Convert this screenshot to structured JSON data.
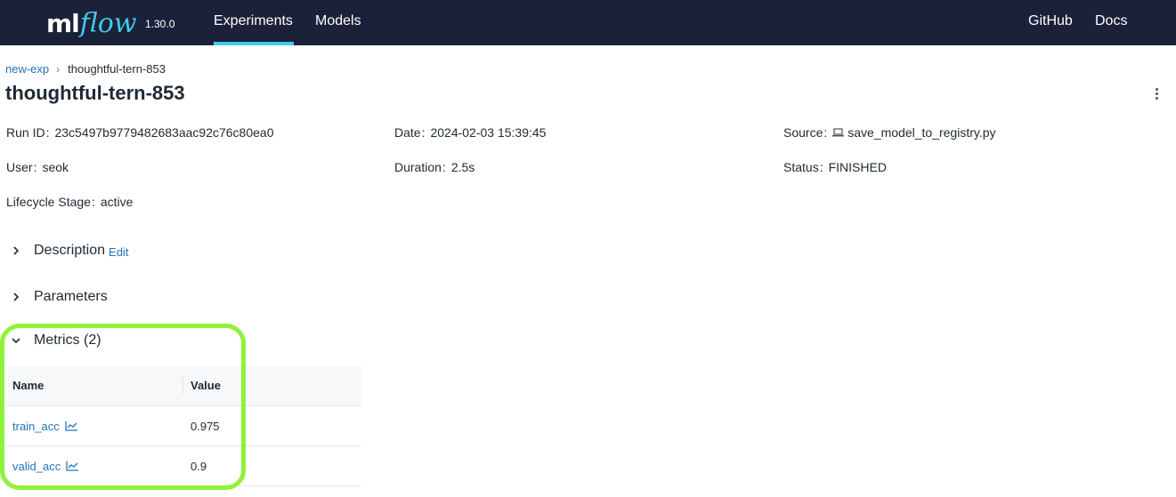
{
  "nav": {
    "logo_ml": "ml",
    "logo_flow": "flow",
    "version": "1.30.0",
    "experiments": "Experiments",
    "models": "Models",
    "github": "GitHub",
    "docs": "Docs",
    "accent_color": "#43c9ed",
    "background_color": "#1b2138"
  },
  "breadcrumb": {
    "parent": "new-exp",
    "separator": "›",
    "current": "thoughtful-tern-853"
  },
  "page": {
    "title": "thoughtful-tern-853",
    "menu_icon": "kebab-menu-icon"
  },
  "metadata": {
    "run_id": {
      "key": "Run ID",
      "value": "23c5497b9779482683aac92c76c80ea0"
    },
    "date": {
      "key": "Date",
      "value": "2024-02-03 15:39:45"
    },
    "source": {
      "key": "Source",
      "value": "save_model_to_registry.py",
      "icon": "laptop-icon"
    },
    "user": {
      "key": "User",
      "value": "seok"
    },
    "duration": {
      "key": "Duration",
      "value": "2.5s"
    },
    "status": {
      "key": "Status",
      "value": "FINISHED"
    },
    "lifecycle": {
      "key": "Lifecycle Stage",
      "value": "active"
    },
    "colon": ":"
  },
  "sections": {
    "description": {
      "title": "Description",
      "edit": "Edit",
      "expanded": false
    },
    "parameters": {
      "title": "Parameters",
      "expanded": false
    },
    "metrics": {
      "title": "Metrics (2)",
      "expanded": true
    }
  },
  "metrics_table": {
    "headers": {
      "name": "Name",
      "value": "Value"
    },
    "rows": [
      {
        "name": "train_acc",
        "value": "0.975",
        "icon": "line-chart-icon"
      },
      {
        "name": "valid_acc",
        "value": "0.9",
        "icon": "line-chart-icon"
      }
    ]
  },
  "highlight_color": "#8ef23a",
  "link_color": "#2374bb"
}
